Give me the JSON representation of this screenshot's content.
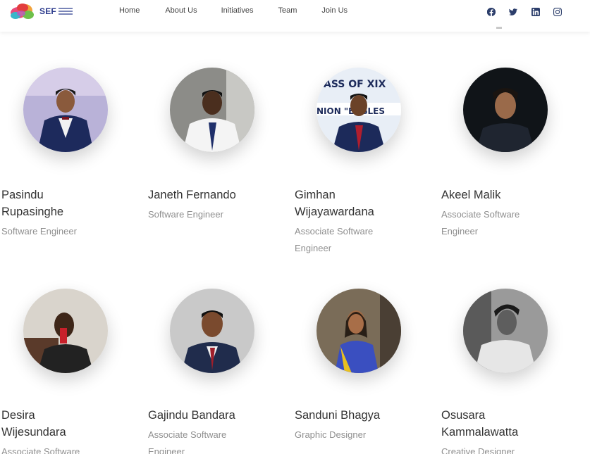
{
  "brand": {
    "logo_text": "SEF",
    "logo_alt": "Sustainable Education Foundation"
  },
  "nav": {
    "items": [
      {
        "label": "Home"
      },
      {
        "label": "About Us"
      },
      {
        "label": "Initiatives"
      },
      {
        "label": "Team"
      },
      {
        "label": "Join Us"
      }
    ]
  },
  "social": {
    "icons": [
      "facebook-icon",
      "twitter-icon",
      "linkedin-icon",
      "instagram-icon"
    ],
    "color": "#2c3e6b"
  },
  "colors": {
    "name": "#333333",
    "role": "#8f8f8f",
    "accent": "#2b3a8c"
  },
  "team": {
    "members": [
      {
        "name": "Pasindu Rupasinghe",
        "name_lines": [
          "Pasindu",
          "Rupasinghe"
        ],
        "role_lines": [
          "Software Engineer"
        ]
      },
      {
        "name": "Janeth Fernando",
        "name_lines": [
          "Janeth Fernando"
        ],
        "role_lines": [
          "Software Engineer"
        ]
      },
      {
        "name": "Gimhan Wijayawardana",
        "name_lines": [
          "Gimhan",
          "Wijayawardana"
        ],
        "role_lines": [
          "Associate Software",
          "Engineer"
        ]
      },
      {
        "name": "Akeel Malik",
        "name_lines": [
          "Akeel Malik"
        ],
        "role_lines": [
          "Associate Software",
          "Engineer"
        ]
      },
      {
        "name": "Desira Wijesundara",
        "name_lines": [
          "Desira",
          "Wijesundara"
        ],
        "role_lines": [
          "Associate Software"
        ]
      },
      {
        "name": "Gajindu Bandara",
        "name_lines": [
          "Gajindu Bandara"
        ],
        "role_lines": [
          "Associate Software",
          "Engineer"
        ]
      },
      {
        "name": "Sanduni Bhagya",
        "name_lines": [
          "Sanduni Bhagya"
        ],
        "role_lines": [
          "Graphic Designer"
        ]
      },
      {
        "name": "Osusara Kammalawatta",
        "name_lines": [
          "Osusara",
          "Kammalawatta"
        ],
        "role_lines": [
          "Creative Designer"
        ]
      }
    ]
  }
}
